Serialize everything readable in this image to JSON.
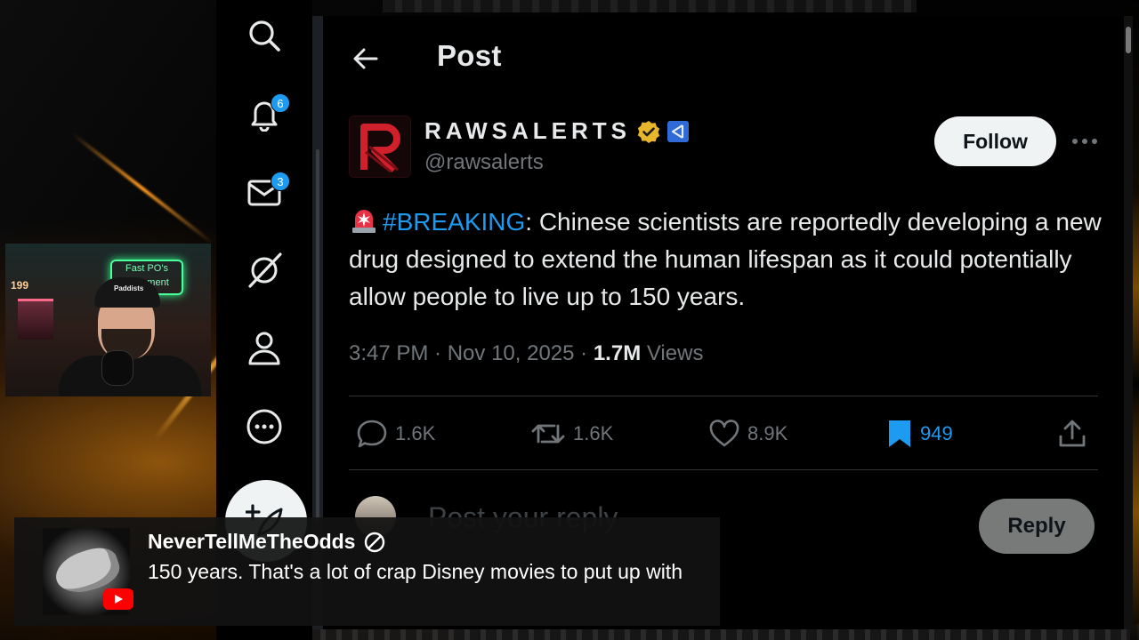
{
  "post_header": {
    "title": "Post"
  },
  "author": {
    "display_name": "RAWSALERTS",
    "handle": "@rawsalerts",
    "follow_label": "Follow",
    "avatar_letter": "R"
  },
  "post": {
    "hashtag": "#BREAKING",
    "body": ": Chinese scientists are reportedly developing a new drug designed to extend the human lifespan as it could potentially allow people to live up to 150 years.",
    "time": "3:47 PM",
    "date": "Nov 10, 2025",
    "views_count": "1.7M",
    "views_label": "Views"
  },
  "stats": {
    "replies": "1.6K",
    "reposts": "1.6K",
    "likes": "8.9K",
    "bookmarks": "949"
  },
  "reply": {
    "placeholder": "Post your reply",
    "button_label": "Reply"
  },
  "nav": {
    "notifications_badge": "6",
    "messages_badge": "3"
  },
  "webcam": {
    "neon_sign": "Fast PO's Basement",
    "cabinet_number": "199",
    "hat_text": "Paddists"
  },
  "chat": {
    "author": "NeverTellMeTheOdds",
    "message": "150 years. That's a lot of crap Disney movies to put up with"
  },
  "colors": {
    "accent": "#1d9bf0",
    "text": "#e7e9ea",
    "muted": "#71767b",
    "background": "#000000",
    "verified": "#f4c542"
  }
}
